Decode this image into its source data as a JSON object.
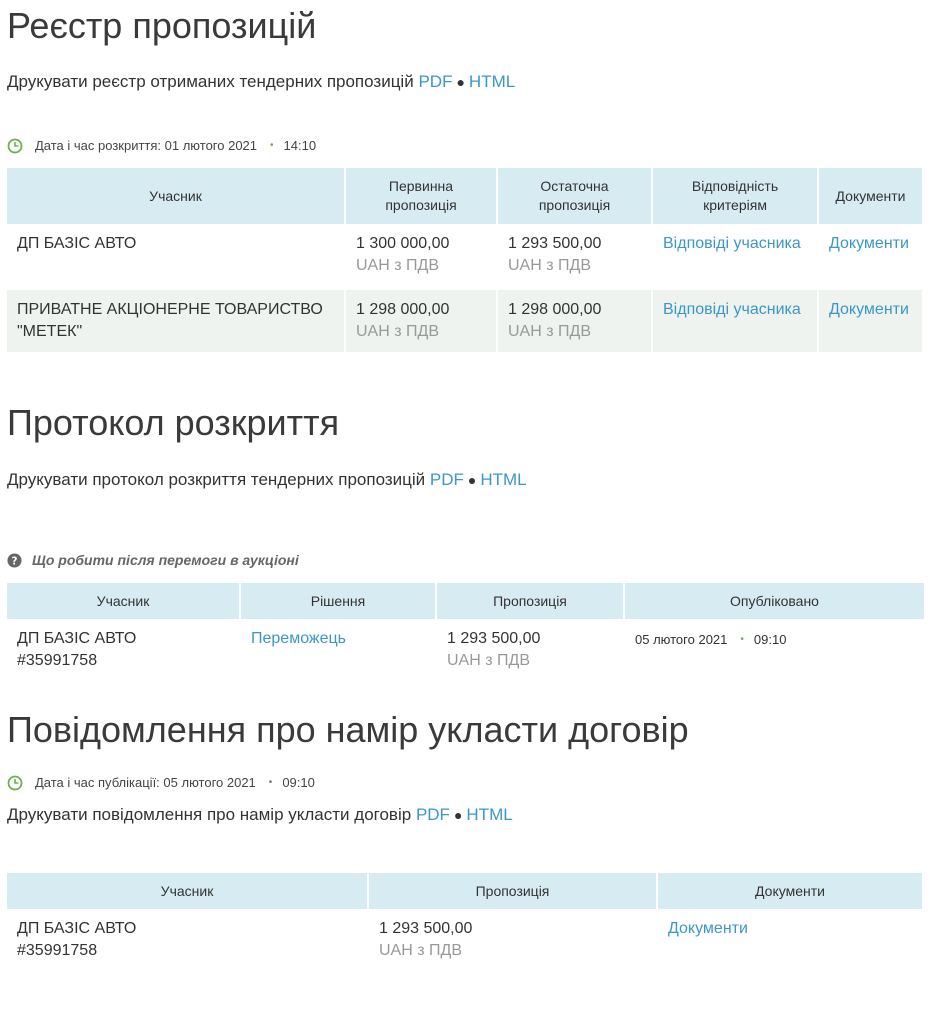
{
  "registry": {
    "title": "Реєстр пропозицій",
    "print_text": "Друкувати реєстр отриманих тендерних пропозицій",
    "pdf": "PDF",
    "html": "HTML",
    "opening_label": "Дата і час розкриття: 01 лютого 2021",
    "opening_time": "14:10",
    "columns": [
      "Учасник",
      "Первинна пропозиція",
      "Остаточна пропозиція",
      "Відповідність критеріям",
      "Документи"
    ],
    "rows": [
      {
        "participant": "ДП БАЗІС АВТО",
        "initial": "1 300 000,00",
        "initial_sub": "UAH з ПДВ",
        "final": "1 293 500,00",
        "final_sub": "UAH з ПДВ",
        "criteria": "Відповіді учасника",
        "docs": "Документи"
      },
      {
        "participant": "ПРИВАТНЕ АКЦІОНЕРНЕ ТОВАРИСТВО \"МЕТЕК\"",
        "initial": "1 298 000,00",
        "initial_sub": "UAH з ПДВ",
        "final": "1 298 000,00",
        "final_sub": "UAH з ПДВ",
        "criteria": "Відповіді учасника",
        "docs": "Документи"
      }
    ]
  },
  "protocol": {
    "title": "Протокол розкриття",
    "print_text": "Друкувати протокол розкриття тендерних пропозицій",
    "pdf": "PDF",
    "html": "HTML",
    "help_text": "Що робити після перемоги в аукціоні",
    "columns": [
      "Учасник",
      "Рішення",
      "Пропозиція",
      "Опубліковано"
    ],
    "rows": [
      {
        "participant": "ДП БАЗІС АВТО",
        "participant_id": "#35991758",
        "decision": "Переможець",
        "offer": "1 293 500,00",
        "offer_sub": "UAH з ПДВ",
        "published_date": "05 лютого 2021",
        "published_time": "09:10"
      }
    ]
  },
  "intent": {
    "title": "Повідомлення про намір укласти договір",
    "publication_label": "Дата і час публікації: 05 лютого 2021",
    "publication_time": "09:10",
    "print_text": "Друкувати повідомлення про намір укласти договір",
    "pdf": "PDF",
    "html": "HTML",
    "columns": [
      "Учасник",
      "Пропозиція",
      "Документи"
    ],
    "rows": [
      {
        "participant": "ДП БАЗІС АВТО",
        "participant_id": "#35991758",
        "offer": "1 293 500,00",
        "offer_sub": "UAH з ПДВ",
        "docs": "Документи"
      }
    ]
  },
  "colors": {
    "link": "#3b97c8",
    "header_bg": "#d6ebf2",
    "row_alt_bg": "#eef3ef",
    "muted": "#999999",
    "accent_green": "#6ab04c"
  }
}
